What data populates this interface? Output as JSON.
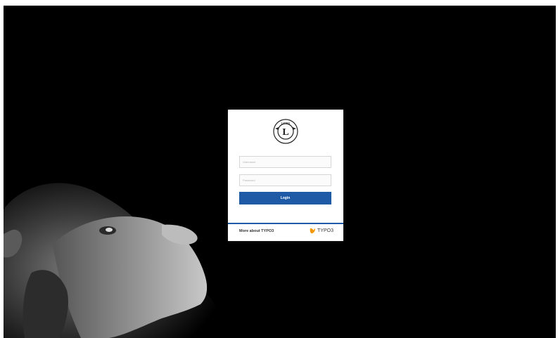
{
  "login": {
    "username_placeholder": "Username",
    "password_placeholder": "Password",
    "login_label": "Login"
  },
  "footer": {
    "more_link": "More about TYPO3",
    "brand_text": "TYPO3"
  },
  "logo": {
    "text": "LIONS"
  },
  "colors": {
    "background": "#000000",
    "accent": "#1f5aa6",
    "typo3_orange": "#f49700"
  },
  "icons": {
    "logo": "lions-logo-icon",
    "brand": "typo3-icon"
  }
}
